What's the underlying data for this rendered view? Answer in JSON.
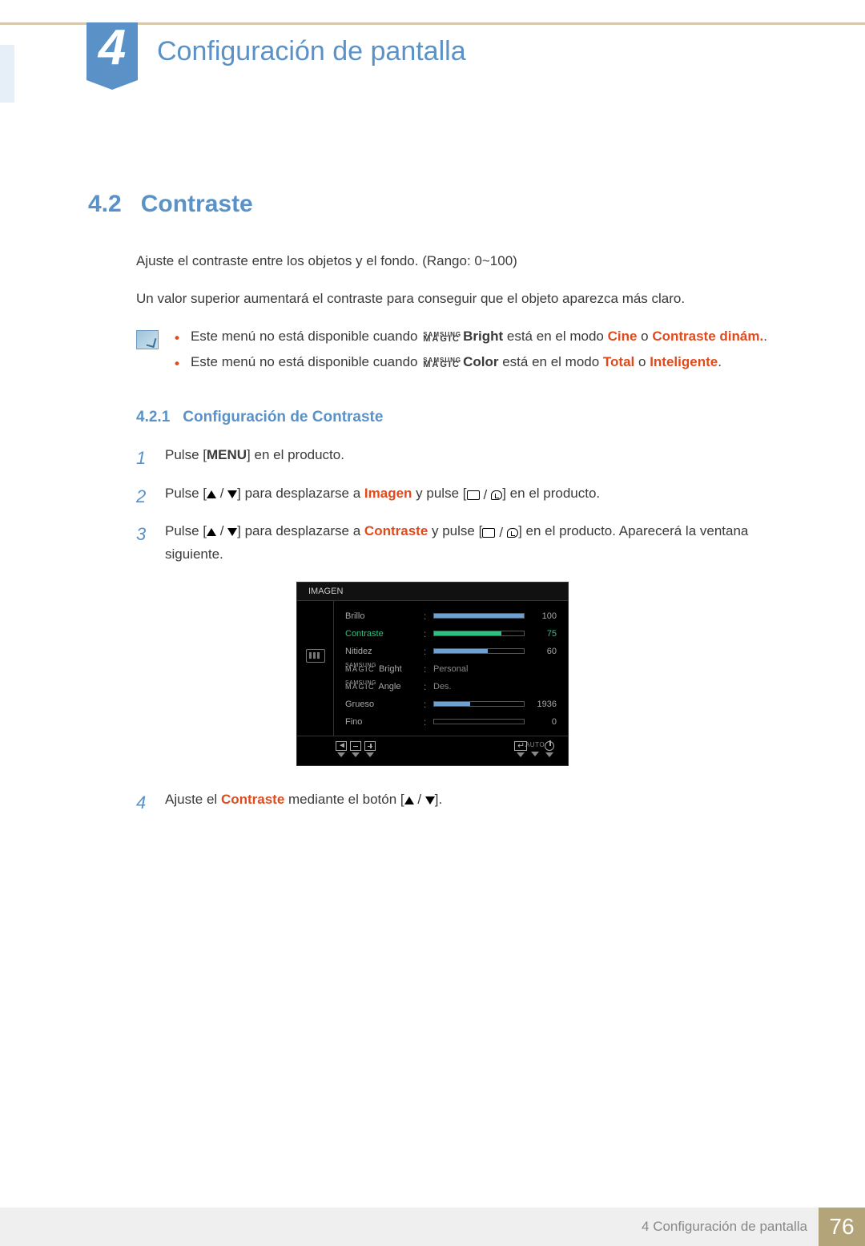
{
  "chapter": {
    "number": "4",
    "title": "Configuración de pantalla"
  },
  "section": {
    "number": "4.2",
    "title": "Contraste",
    "intro1": "Ajuste el contraste entre los objetos y el fondo. (Rango: 0~100)",
    "intro2": "Un valor superior aumentará el contraste para conseguir que el objeto aparezca más claro.",
    "note1_pre": "Este menú no está disponible cuando ",
    "note1_bright": "Bright",
    "note1_mid": " está en el modo ",
    "note1_cine": "Cine",
    "note1_or": " o ",
    "note1_dinam": "Contraste dinám.",
    "note1_end": ".",
    "note2_pre": "Este menú no está disponible cuando ",
    "note2_color": "Color",
    "note2_mid": " está en el modo ",
    "note2_total": "Total",
    "note2_or": " o ",
    "note2_intel": "Inteligente",
    "note2_end": "."
  },
  "subsection": {
    "number": "4.2.1",
    "title": "Configuración de Contraste"
  },
  "magic": {
    "brand": "SAMSUNG",
    "text": "MAGIC"
  },
  "steps": {
    "s1_a": "Pulse [",
    "s1_menu": "MENU",
    "s1_b": "] en el producto.",
    "s2_a": "Pulse [",
    "s2_b": "] para desplazarse a ",
    "s2_imagen": "Imagen",
    "s2_c": " y pulse [",
    "s2_d": "] en el producto.",
    "s3_a": "Pulse [",
    "s3_b": "] para desplazarse a ",
    "s3_contraste": "Contraste",
    "s3_c": " y pulse [",
    "s3_d": "] en el producto. Aparecerá la ventana siguiente.",
    "s4_a": "Ajuste el ",
    "s4_contraste": "Contraste",
    "s4_b": " mediante el botón [",
    "s4_c": "]."
  },
  "osd": {
    "title": "IMAGEN",
    "items": [
      {
        "label": "Brillo",
        "value": 100,
        "fill": 100,
        "type": "slider"
      },
      {
        "label": "Contraste",
        "value": 75,
        "fill": 75,
        "type": "slider",
        "active": true
      },
      {
        "label": "Nitidez",
        "value": 60,
        "fill": 60,
        "type": "slider"
      },
      {
        "label_magic": "Bright",
        "text": "Personal",
        "type": "text"
      },
      {
        "label_magic": "Angle",
        "text": "Des.",
        "type": "text"
      },
      {
        "label": "Grueso",
        "value": 1936,
        "fill": 40,
        "type": "slider"
      },
      {
        "label": "Fino",
        "value": 0,
        "fill": 0,
        "type": "slider"
      }
    ],
    "auto": "AUTO"
  },
  "footer": {
    "text": "4 Configuración de pantalla",
    "page": "76"
  }
}
